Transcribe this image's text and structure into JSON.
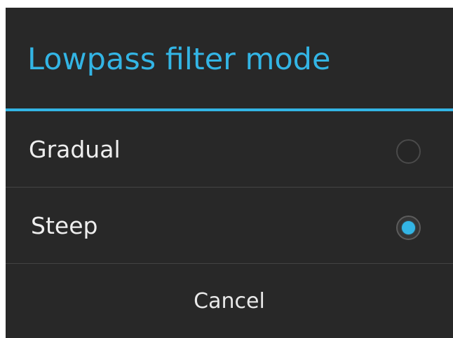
{
  "dialog": {
    "title": "Lowpass filter mode",
    "accent_color": "#33b5e5",
    "background_color": "#282828",
    "options": [
      {
        "label": "Gradual",
        "selected": false
      },
      {
        "label": "Steep",
        "selected": true
      }
    ],
    "cancel_label": "Cancel"
  }
}
